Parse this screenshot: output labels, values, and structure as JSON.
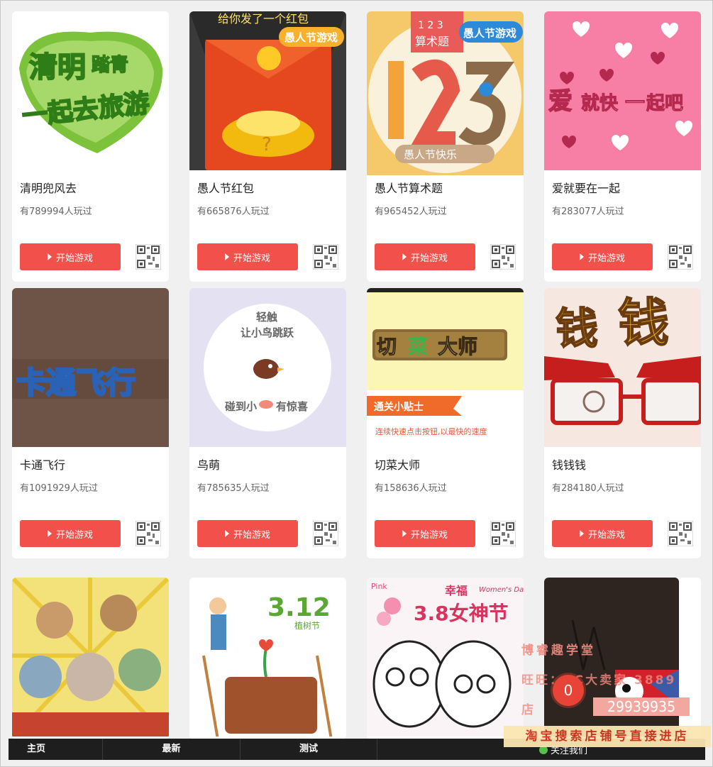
{
  "games": [
    {
      "title": "清明兜风去",
      "plays": "有789994人玩过",
      "button": "开始游戏",
      "thumb_text": [
        "清明",
        "踏青",
        "一起去旅游"
      ]
    },
    {
      "title": "愚人节红包",
      "plays": "有665876人玩过",
      "button": "开始游戏",
      "thumb_text": [
        "给你发了一个红包",
        "愚人节游戏",
        "?"
      ]
    },
    {
      "title": "愚人节算术题",
      "plays": "有965452人玩过",
      "button": "开始游戏",
      "thumb_text": [
        "1 2 3",
        "算术题",
        "愚人节游戏",
        "愚人节快乐"
      ]
    },
    {
      "title": "爱就要在一起",
      "plays": "有283077人玩过",
      "button": "开始游戏",
      "thumb_text": [
        "爱",
        "就快",
        "一",
        "起吧"
      ]
    },
    {
      "title": "卡通飞行",
      "plays": "有1091929人玩过",
      "button": "开始游戏",
      "thumb_text": [
        "卡通飞行"
      ]
    },
    {
      "title": "鸟萌",
      "plays": "有785635人玩过",
      "button": "开始游戏",
      "thumb_text": [
        "轻触",
        "让小鸟跳跃",
        "碰到小",
        "有惊喜"
      ]
    },
    {
      "title": "切菜大师",
      "plays": "有158636人玩过",
      "button": "开始游戏",
      "thumb_text": [
        "切",
        "菜",
        "大师",
        "通关小贴士",
        "连续快速点击按钮,以最快的速度"
      ]
    },
    {
      "title": "钱钱钱",
      "plays": "有284180人玩过",
      "button": "开始游戏",
      "thumb_text": [
        "钱",
        "钱"
      ]
    },
    {
      "title": "",
      "plays": "",
      "button": "",
      "thumb_text": []
    },
    {
      "title": "",
      "plays": "",
      "button": "",
      "thumb_text": [
        "3.12",
        "植树节"
      ]
    },
    {
      "title": "",
      "plays": "",
      "button": "",
      "thumb_text": [
        "Pink",
        "幸福",
        "Women's Day",
        "3.8女神节"
      ]
    },
    {
      "title": "",
      "plays": "",
      "button": "",
      "thumb_text": []
    }
  ],
  "bottom_nav": [
    "主页",
    "最新",
    "测试",
    "关注我们"
  ],
  "badge_count": "0",
  "watermark": {
    "line1": "博睿趣学堂",
    "line2": "旺旺：TC大卖家 3889",
    "line3": "店",
    "phone": "29939935",
    "banner": "淘宝搜索店铺号直接进店"
  },
  "colors": {
    "button": "#f2504b",
    "bar": "#1e1e1e",
    "background": "#f0f0f0"
  }
}
